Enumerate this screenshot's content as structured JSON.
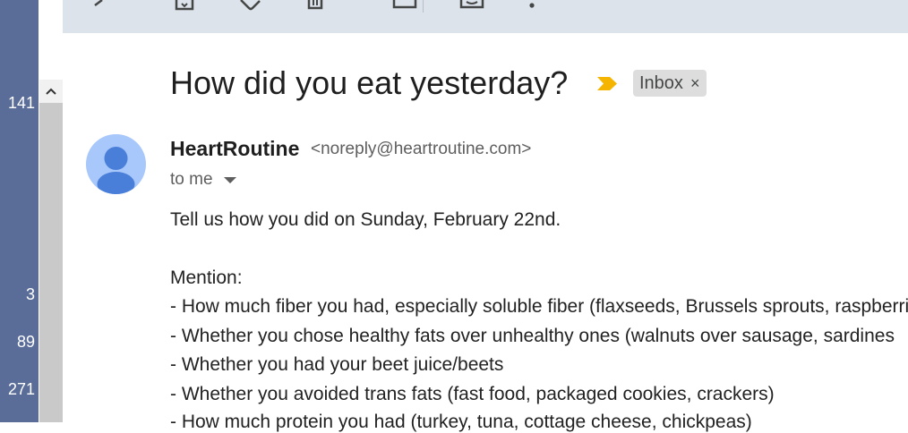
{
  "sidebar": {
    "counts": [
      "141",
      "3",
      "89",
      "271"
    ]
  },
  "toolbar": {
    "icons": [
      "back-arrow-icon",
      "archive-icon",
      "label-icon",
      "delete-icon",
      "mail-icon",
      "snooze-icon",
      "more-vert-icon"
    ]
  },
  "email": {
    "subject": "How did you eat yesterday?",
    "label": "Inbox",
    "label_remove": "×",
    "sender_name": "HeartRoutine",
    "sender_email": "<noreply@heartroutine.com>",
    "recipient": "to me",
    "body": [
      "Tell us how you did on Sunday, February 22nd.",
      "Mention:",
      "- How much fiber you had, especially soluble fiber (flaxseeds, Brussels sprouts, raspberries",
      "- Whether you chose healthy fats over unhealthy ones (walnuts over sausage, sardines",
      "- Whether you had your beet juice/beets",
      "- Whether you avoided trans fats (fast food, packaged cookies, crackers)",
      "- How much protein you had (turkey, tuna, cottage cheese, chickpeas)"
    ]
  },
  "colors": {
    "accent_important": "#f4b400",
    "avatar_bg": "#a8c7fa",
    "avatar_fg": "#4a7fd9",
    "toolbar_bg": "#dde3ea",
    "sidebar_bg": "#5a6d98"
  }
}
